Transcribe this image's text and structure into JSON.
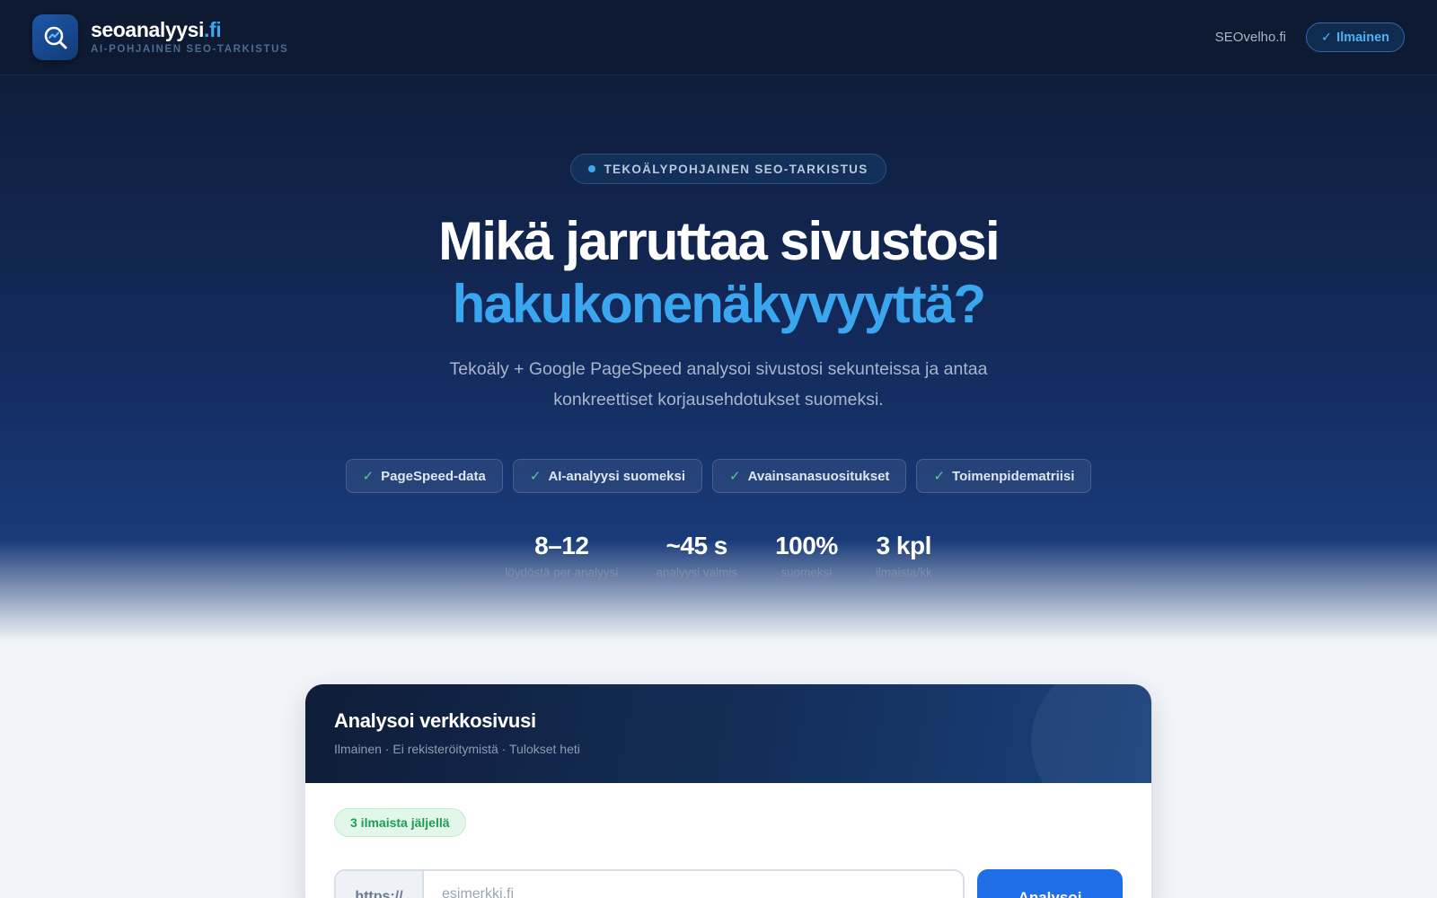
{
  "nav": {
    "brand_name": "seoanalyysi",
    "brand_tld": ".fi",
    "brand_tagline": "AI-POHJAINEN SEO-TARKISTUS",
    "link": "SEOvelho.fi",
    "free_badge_check": "✓",
    "free_badge": "Ilmainen"
  },
  "hero": {
    "badge": "TEKOÄLYPOHJAINEN SEO-TARKISTUS",
    "title_line1": "Mikä jarruttaa sivustosi",
    "title_line2": "hakukonenäkyvyyttä?",
    "subtitle": "Tekoäly + Google PageSpeed analysoi sivustosi sekunteissa ja antaa konkreettiset korjausehdotukset suomeksi.",
    "features": [
      {
        "check": "✓",
        "label": "PageSpeed-data"
      },
      {
        "check": "✓",
        "label": "AI-analyysi suomeksi"
      },
      {
        "check": "✓",
        "label": "Avainsanasuositukset"
      },
      {
        "check": "✓",
        "label": "Toimenpidematriisi"
      }
    ],
    "stats": [
      {
        "value": "8–12",
        "label": "löydöstä per analyysi"
      },
      {
        "value": "~45 s",
        "label": "analyysi valmis"
      },
      {
        "value": "100%",
        "label": "suomeksi"
      },
      {
        "value": "3 kpl",
        "label": "ilmaista/kk"
      }
    ]
  },
  "card": {
    "title": "Analysoi verkkosivusi",
    "subtitle": "Ilmainen · Ei rekisteröitymistä · Tulokset heti",
    "quota": "3 ilmaista jäljellä",
    "url_prefix": "https://",
    "url_placeholder": "esimerkki.fi",
    "url_value": "",
    "button": "Analysoi"
  },
  "colors": {
    "accent": "#3aa6ef",
    "nav_bg": "#0e1a31",
    "button": "#1f6ee8",
    "success": "#1e9c54"
  }
}
